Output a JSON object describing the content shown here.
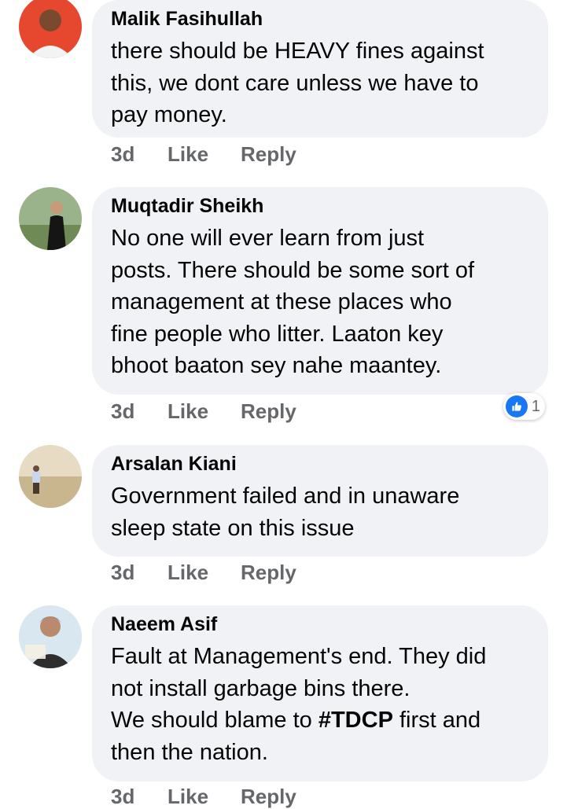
{
  "comments": [
    {
      "author": "Malik Fasihullah",
      "text": "there should be HEAVY fines against\nthis, we dont care unless we have to\npay money.",
      "time": "3d",
      "like_label": "Like",
      "reply_label": "Reply"
    },
    {
      "author": "Muqtadir Sheikh",
      "text": "No one will ever learn from just\nposts. There should be some sort of\nmanagement at these places who\nfine people who litter. Laaton key\nbhoot baaton sey nahe maantey.",
      "time": "3d",
      "like_label": "Like",
      "reply_label": "Reply",
      "reaction_icon": "thumbs-up-icon",
      "reaction_count": "1"
    },
    {
      "author": "Arsalan Kiani",
      "text": "Government failed and in unaware\nsleep state on this issue",
      "time": "3d",
      "like_label": "Like",
      "reply_label": "Reply"
    },
    {
      "author": "Naeem Asif",
      "text_before": "Fault at Management's end. They did\nnot install garbage bins there.\nWe should blame to ",
      "hashtag": "#TDCP",
      "text_after": " first and\nthen the nation.",
      "time": "3d",
      "like_label": "Like",
      "reply_label": "Reply"
    }
  ],
  "colors": {
    "bubble": "#f0f2f5",
    "meta": "#65676b",
    "reaction_blue": "#1877f2"
  }
}
